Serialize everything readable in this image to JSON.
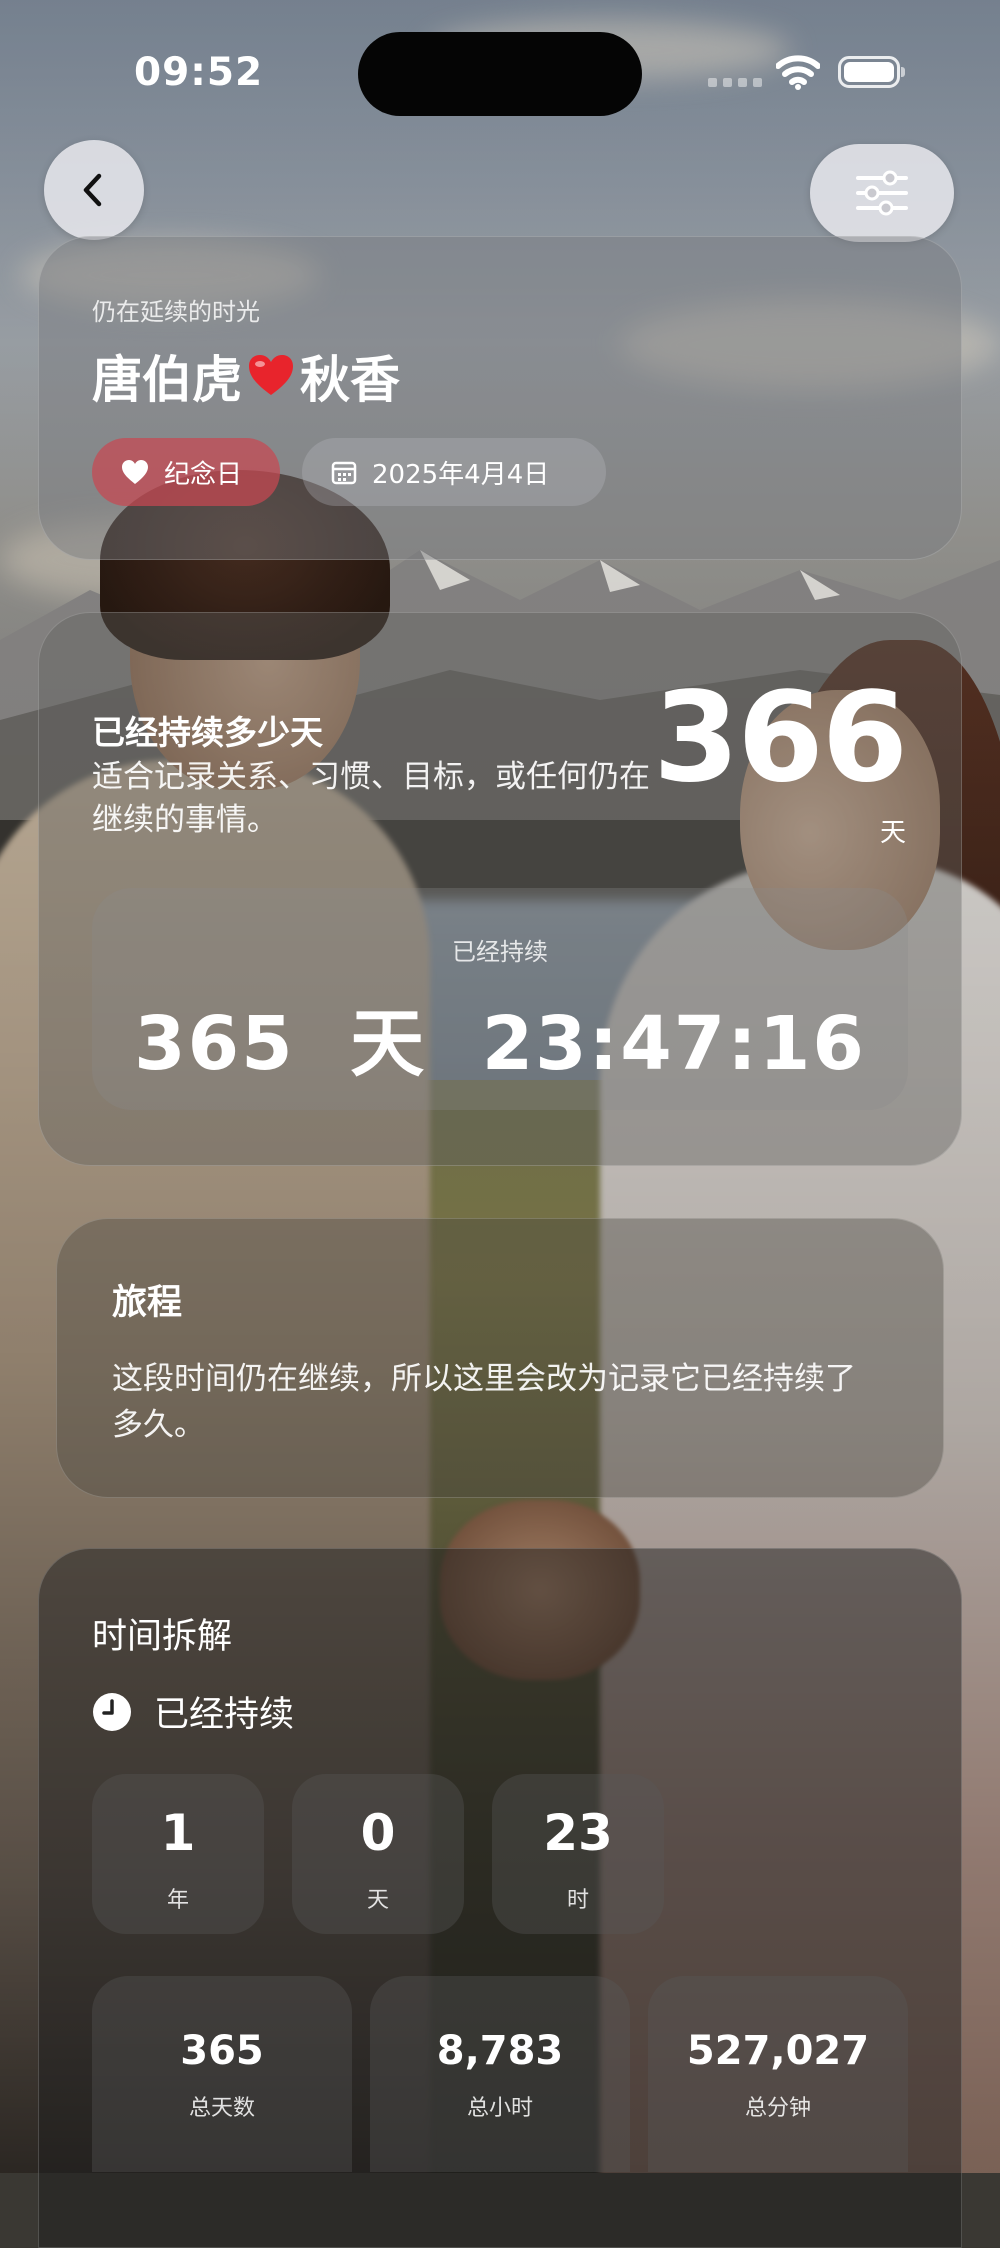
{
  "status_bar": {
    "time": "09:52"
  },
  "header": {
    "back_icon": "chevron-left-icon",
    "filter_icon": "sliders-icon"
  },
  "title_card": {
    "subtitle": "仍在延续的时光",
    "name_left": "唐伯虎",
    "name_right": "秋香",
    "tag_label": "纪念日",
    "date_label": "2025年4月4日",
    "colors": {
      "tag_bg": "#c84852",
      "heart": "#e8242c"
    }
  },
  "duration_card": {
    "heading": "已经持续多少天",
    "description": "适合记录关系、习惯、目标，或任何仍在继续的事情。",
    "day_count": "366",
    "day_unit": "天",
    "inner_label": "已经持续",
    "timer": "365  天  23:47:16"
  },
  "journey_card": {
    "title": "旅程",
    "text": "这段时间仍在继续，所以这里会改为记录它已经持续了多久。"
  },
  "breakdown_card": {
    "title": "时间拆解",
    "subtitle": "已经持续",
    "small_cells": [
      {
        "value": "1",
        "unit": "年"
      },
      {
        "value": "0",
        "unit": "天"
      },
      {
        "value": "23",
        "unit": "时"
      }
    ],
    "large_cells": [
      {
        "value": "365",
        "unit": "总天数"
      },
      {
        "value": "8,783",
        "unit": "总小时"
      },
      {
        "value": "527,027",
        "unit": "总分钟"
      }
    ]
  }
}
